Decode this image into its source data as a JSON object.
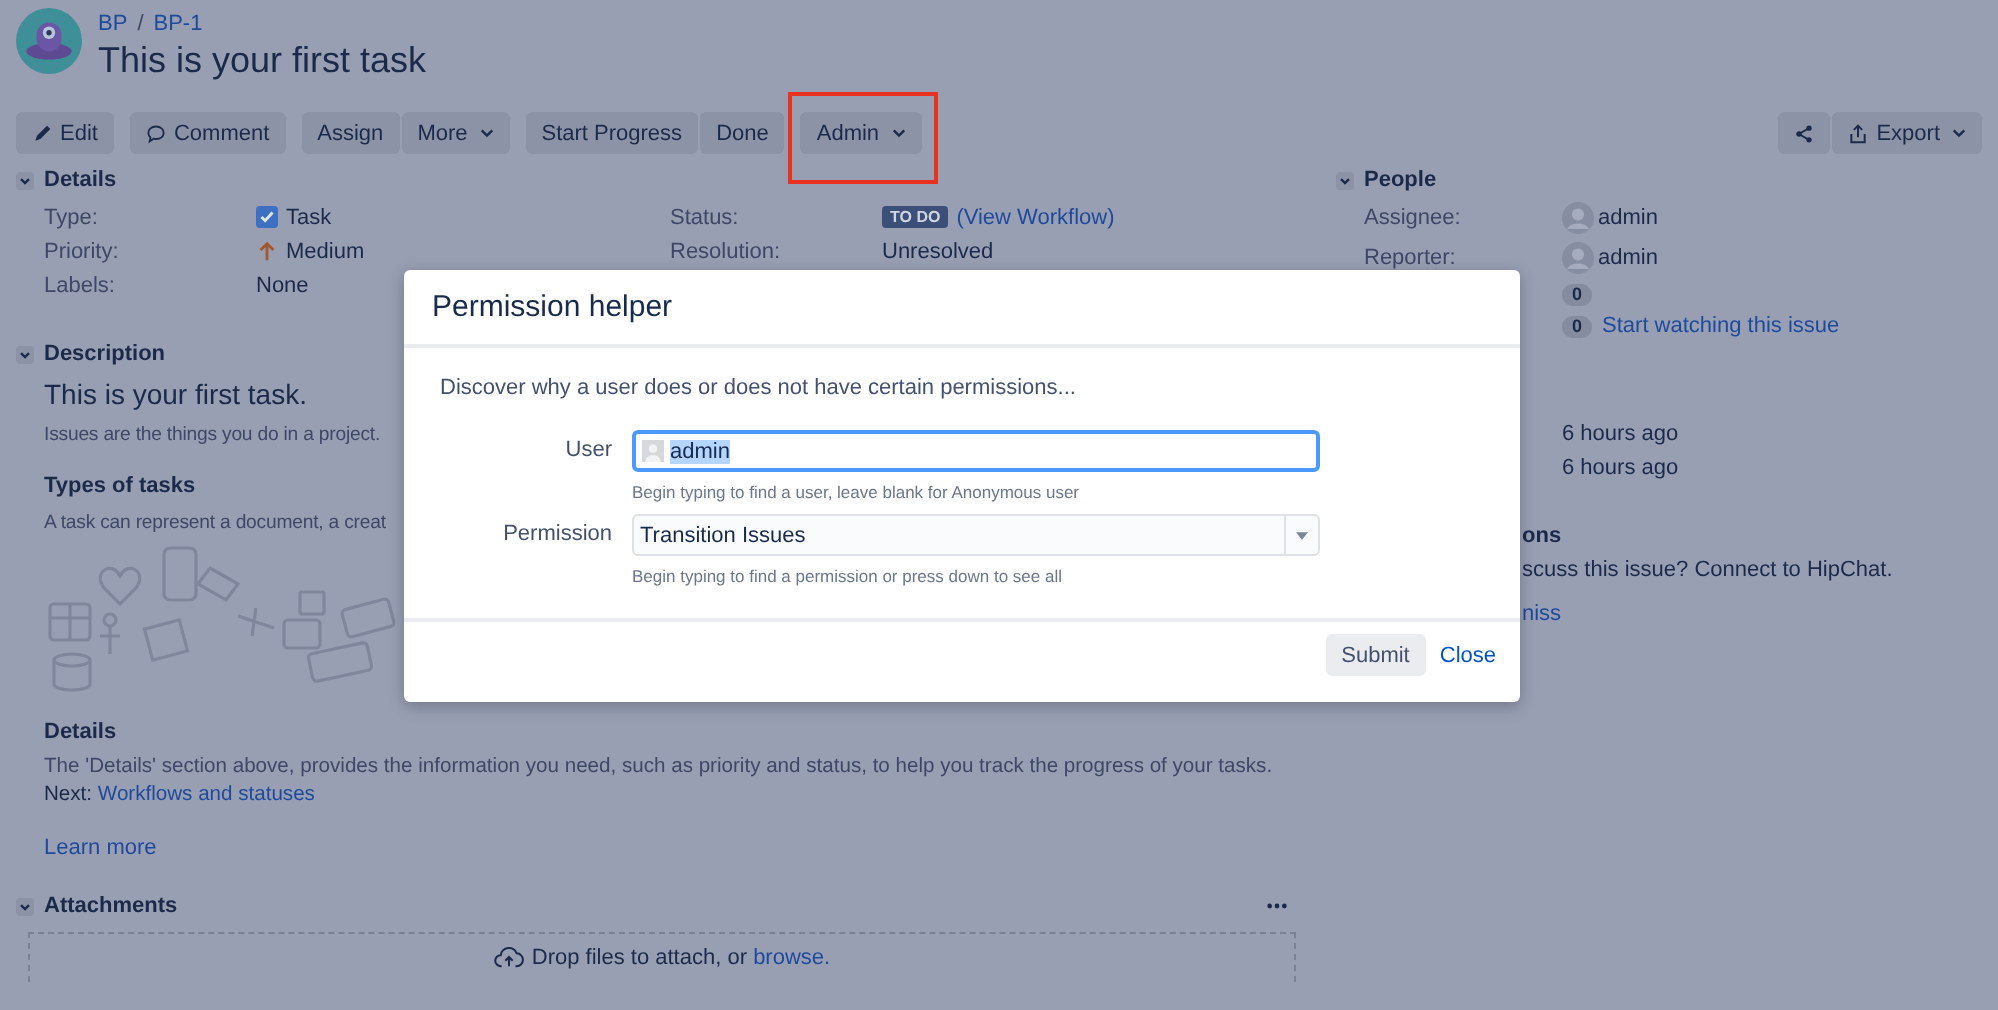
{
  "breadcrumbs": [
    {
      "label": "BP"
    },
    {
      "label": "BP-1"
    }
  ],
  "breadcrumb_separator": "/",
  "title": "This is your first task",
  "toolbar": {
    "groups": [
      [
        {
          "label": "Edit",
          "kind": "edit"
        }
      ],
      [
        {
          "label": "Comment",
          "kind": "comment"
        }
      ],
      [
        {
          "label": "Assign",
          "kind": "plain"
        },
        {
          "label": "More",
          "kind": "dropdown"
        }
      ],
      [
        {
          "label": "Start Progress",
          "kind": "plain"
        },
        {
          "label": "Done",
          "kind": "plain"
        }
      ],
      [
        {
          "label": "Admin",
          "kind": "dropdown",
          "highlighted": true
        }
      ]
    ],
    "right": [
      {
        "kind": "share"
      },
      {
        "label": "Export",
        "kind": "export"
      }
    ]
  },
  "details": {
    "title": "Details",
    "expanded": true,
    "left": [
      {
        "label": "Type:",
        "value": "Task",
        "kind": "type"
      },
      {
        "label": "Priority:",
        "value": "Medium",
        "kind": "priority"
      },
      {
        "label": "Labels:",
        "value": "None",
        "kind": "text"
      }
    ],
    "right": [
      {
        "label": "Status:",
        "badge": "TO DO",
        "link": "(View Workflow)",
        "kind": "status"
      },
      {
        "label": "Resolution:",
        "value": "Unresolved",
        "kind": "text"
      }
    ]
  },
  "description": {
    "title": "Description",
    "expanded": true,
    "heading": "This is your first task.",
    "intro": "Issues are the things you do in a project.",
    "subheading": "Types of tasks",
    "text": "A task can represent a document, a creat",
    "details_heading": "Details",
    "details_text": "The 'Details' section above, provides the information you need, such as priority and status, to help you track the progress of your tasks.",
    "next_label": "Next:",
    "next_link": "Workflows and statuses",
    "learn_more": "Learn more"
  },
  "attachments": {
    "title": "Attachments",
    "expanded": true,
    "drop_text": "Drop files to attach, or",
    "browse": "browse."
  },
  "people": {
    "title": "People",
    "expanded": true,
    "rows": [
      {
        "label": "Assignee:",
        "value": "admin"
      },
      {
        "label": "Reporter:",
        "value": "admin"
      }
    ],
    "counts": [
      {
        "count": "0"
      },
      {
        "count": "0",
        "link": "Start watching this issue"
      }
    ]
  },
  "dates": [
    "6 hours ago",
    "6 hours ago"
  ],
  "hipchat": {
    "heading": "ons",
    "text": "scuss this issue? Connect to HipChat.",
    "link": "niss"
  },
  "dialog": {
    "title": "Permission helper",
    "intro": "Discover why a user does or does not have certain permissions...",
    "fields": [
      {
        "label": "User",
        "value": "admin",
        "hint": "Begin typing to find a user, leave blank for Anonymous user",
        "kind": "user",
        "focused": true
      },
      {
        "label": "Permission",
        "value": "Transition Issues",
        "hint": "Begin typing to find a permission or press down to see all",
        "kind": "select",
        "focused": false
      }
    ],
    "buttons": [
      {
        "label": "Submit",
        "kind": "button"
      },
      {
        "label": "Close",
        "kind": "link"
      }
    ]
  }
}
